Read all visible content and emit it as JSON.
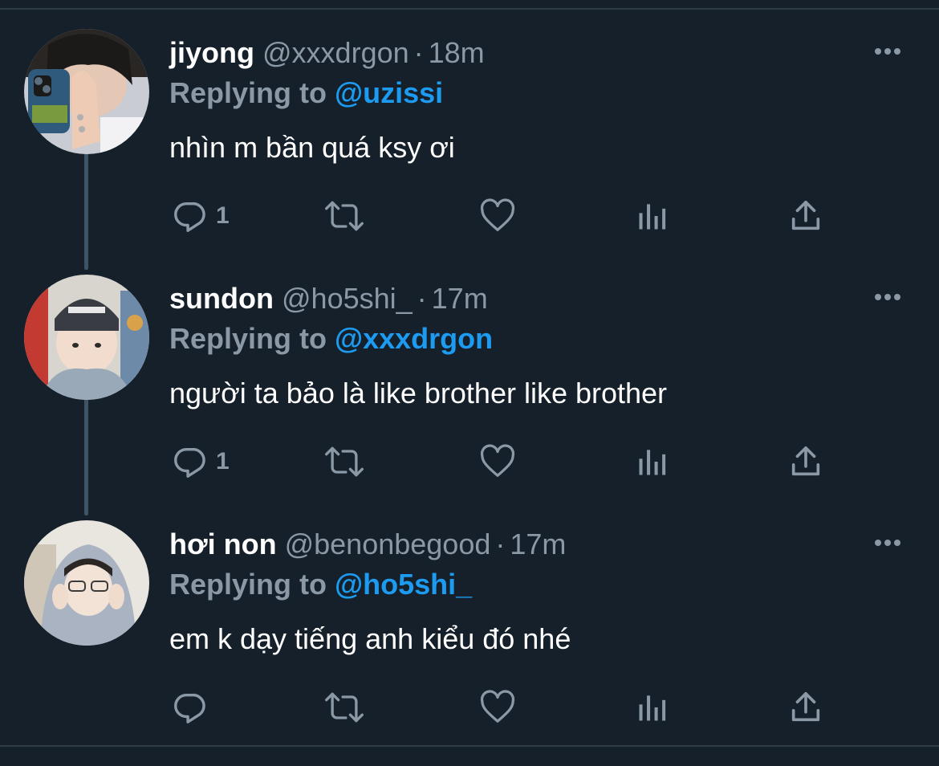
{
  "colors": {
    "background": "#15202b",
    "text_primary": "#ffffff",
    "text_secondary": "#8b98a5",
    "accent": "#1d9bf0",
    "thread_line": "#3d5466"
  },
  "icons": {
    "reply": "reply-icon",
    "retweet": "retweet-icon",
    "like": "heart-icon",
    "views": "analytics-icon",
    "share": "share-icon",
    "more": "more-horizontal-icon"
  },
  "tweets": [
    {
      "name": "jiyong",
      "handle": "@xxxdrgon",
      "separator": "·",
      "time": "18m",
      "replying_prefix": "Replying to",
      "replying_to": "@uzissi",
      "text": "nhìn m bần quá ksy ơi",
      "reply_count": "1",
      "avatar": "avatar-photo-jiyong"
    },
    {
      "name": "sundon",
      "handle": "@ho5shi_",
      "separator": "·",
      "time": "17m",
      "replying_prefix": "Replying to",
      "replying_to": "@xxxdrgon",
      "text": "người ta bảo là like brother like brother",
      "reply_count": "1",
      "avatar": "avatar-photo-sundon"
    },
    {
      "name": "hơi non",
      "handle": "@benonbegood",
      "separator": "·",
      "time": "17m",
      "replying_prefix": "Replying to",
      "replying_to": "@ho5shi_",
      "text": "em k dạy tiếng anh kiểu đó nhé",
      "reply_count": "",
      "avatar": "avatar-photo-hoinon"
    }
  ]
}
